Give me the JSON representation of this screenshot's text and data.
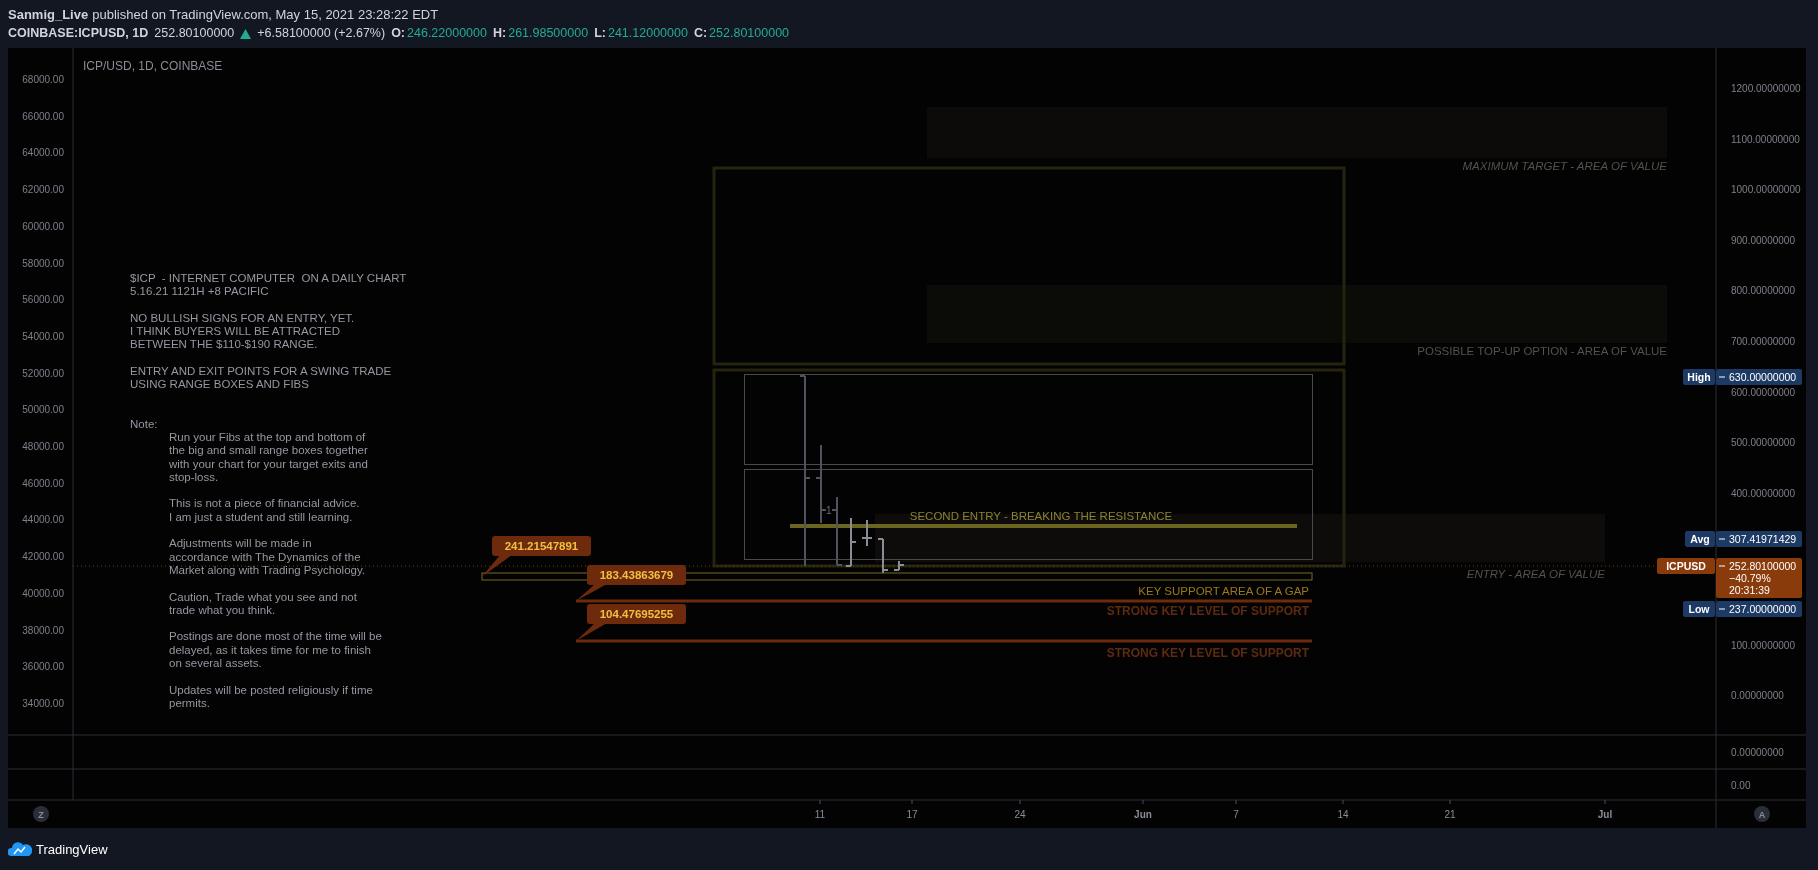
{
  "header": {
    "author": "Sanmig_Live",
    "published": "published on TradingView.com, May 15, 2021 23:28:22 EDT"
  },
  "symbol_bar": {
    "symbol": "COINBASE:ICPUSD, 1D",
    "last": "252.80100000",
    "up": true,
    "change": "+6.58100000 (+2.67%)",
    "ohlc": [
      {
        "key": "O:",
        "value": "246.22000000"
      },
      {
        "key": "H:",
        "value": "261.98500000"
      },
      {
        "key": "L:",
        "value": "241.12000000"
      },
      {
        "key": "C:",
        "value": "252.80100000"
      }
    ]
  },
  "chart": {
    "title": "ICP/USD, 1D, COINBASE",
    "note": {
      "paragraphs": [
        "$ICP  - INTERNET COMPUTER  ON A DAILY CHART\n5.16.21 1121H +8 PACIFIC",
        "NO BULLISH SIGNS FOR AN ENTRY, YET.\nI THINK BUYERS WILL BE ATTRACTED\nBETWEEN THE $110-$190 RANGE.",
        "ENTRY AND EXIT POINTS FOR A SWING TRADE\nUSING RANGE BOXES AND FIBS"
      ],
      "label": "Note:",
      "items": [
        "Run your Fibs at the top and bottom of\nthe big and small range boxes together\nwith your chart for your target exits and\nstop-loss.",
        "This is not a piece of financial advice.\nI am just a student and still learning.",
        "Adjustments will be made in\naccordance with The Dynamics of the\nMarket along with Trading Psychology.",
        "Caution, Trade what you see and not\ntrade what you think.",
        "Postings are done most of the time will be\ndelayed, as it takes time for me to finish\non several assets.",
        "Updates will be posted religiously if time\npermits."
      ]
    },
    "left_axis_ticks": [
      "68000.00",
      "66000.00",
      "64000.00",
      "62000.00",
      "60000.00",
      "58000.00",
      "56000.00",
      "54000.00",
      "52000.00",
      "50000.00",
      "48000.00",
      "46000.00",
      "44000.00",
      "42000.00",
      "40000.00",
      "38000.00",
      "36000.00",
      "34000.00"
    ],
    "right_axis_ticks": [
      "1200.00000000",
      "1100.00000000",
      "1000.00000000",
      "900.00000000",
      "800.00000000",
      "700.00000000",
      "600.00000000",
      "500.00000000",
      "400.00000000",
      "100.00000000",
      "0.00000000"
    ],
    "zones": [
      {
        "kind": "max_target",
        "label": "MAXIMUM TARGET - AREA OF VALUE"
      },
      {
        "kind": "top_up",
        "label": "POSSIBLE TOP-UP OPTION - AREA OF VALUE"
      },
      {
        "kind": "entry",
        "label": "ENTRY - AREA OF VALUE"
      }
    ],
    "second_entry": {
      "label": "SECOND ENTRY - BREAKING THE RESISTANCE"
    },
    "bar_marker": "1",
    "levels": [
      {
        "kind": "gap",
        "label": "KEY SUPPORT AREA OF A GAP",
        "callout": "241.21547891"
      },
      {
        "kind": "strong",
        "label": "STRONG KEY LEVEL OF SUPPORT",
        "callout": "183.43863679"
      },
      {
        "kind": "strong",
        "label": "STRONG KEY LEVEL OF SUPPORT",
        "callout": "104.47695255"
      }
    ],
    "price_tags": [
      {
        "kind": "stat",
        "label": "High",
        "value": "630.00000000"
      },
      {
        "kind": "stat",
        "label": "Avg",
        "value": "307.41971429"
      },
      {
        "kind": "last",
        "label": "ICPUSD",
        "value": "252.80100000",
        "extra": [
          "−40.79%",
          "20:31:39"
        ]
      },
      {
        "kind": "stat",
        "label": "Low",
        "value": "237.00000000"
      }
    ],
    "pane_ticks": [
      "0.00000000",
      "0.00"
    ],
    "time_ticks": [
      {
        "kind": "day",
        "label": "11"
      },
      {
        "kind": "day",
        "label": "17"
      },
      {
        "kind": "day",
        "label": "24"
      },
      {
        "kind": "month",
        "label": "Jun"
      },
      {
        "kind": "day",
        "label": "7"
      },
      {
        "kind": "day",
        "label": "14"
      },
      {
        "kind": "day",
        "label": "21"
      },
      {
        "kind": "month",
        "label": "Jul"
      }
    ],
    "left_button": "Z",
    "right_button": "A"
  },
  "footer": {
    "brand": "TradingView"
  }
}
